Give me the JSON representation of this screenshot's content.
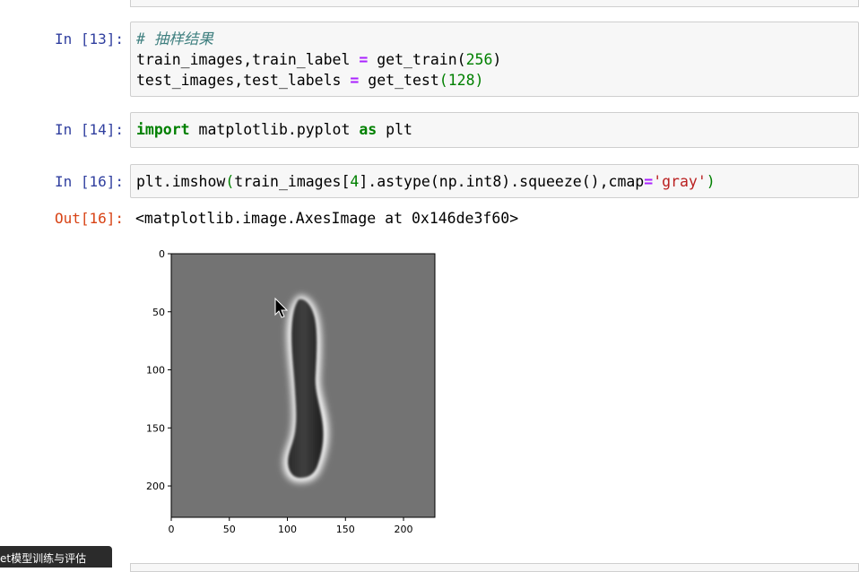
{
  "cells": [
    {
      "prompt": "In [13]:",
      "lines": [
        [
          {
            "t": "# 抽样结果",
            "c": "cmt"
          }
        ],
        [
          {
            "t": "train_images,train_label ",
            "c": ""
          },
          {
            "t": "=",
            "c": "op"
          },
          {
            "t": " get_train(",
            "c": ""
          },
          {
            "t": "256",
            "c": "num"
          },
          {
            "t": ")",
            "c": ""
          }
        ],
        [
          {
            "t": "test_images,test_labels ",
            "c": ""
          },
          {
            "t": "=",
            "c": "op"
          },
          {
            "t": " get_test",
            "c": ""
          },
          {
            "t": "(",
            "c": "paren-g"
          },
          {
            "t": "128",
            "c": "num"
          },
          {
            "t": ")",
            "c": "paren-g"
          }
        ]
      ]
    },
    {
      "prompt": "In [14]:",
      "lines": [
        [
          {
            "t": "import",
            "c": "kw"
          },
          {
            "t": " matplotlib.pyplot ",
            "c": ""
          },
          {
            "t": "as",
            "c": "kw"
          },
          {
            "t": " plt",
            "c": ""
          }
        ]
      ]
    },
    {
      "prompt": "In [16]:",
      "lines": [
        [
          {
            "t": "plt.imshow",
            "c": ""
          },
          {
            "t": "(",
            "c": "paren-g"
          },
          {
            "t": "train_images[",
            "c": ""
          },
          {
            "t": "4",
            "c": "num"
          },
          {
            "t": "].astype(np.int8).squeeze(),cmap",
            "c": ""
          },
          {
            "t": "=",
            "c": "op"
          },
          {
            "t": "'gray'",
            "c": "str"
          },
          {
            "t": ")",
            "c": "paren-g"
          }
        ]
      ]
    }
  ],
  "output": {
    "prompt": "Out[16]:",
    "text": "<matplotlib.image.AxesImage at 0x146de3f60>"
  },
  "plot": {
    "cmap": "gray",
    "xlim": [
      0,
      227
    ],
    "ylim": [
      227,
      0
    ],
    "xticks": [
      "0",
      "50",
      "100",
      "150",
      "200"
    ],
    "yticks": [
      "0",
      "50",
      "100",
      "150",
      "200"
    ],
    "background_color": "#737373"
  },
  "toast": {
    "text": "et模型训练与评估"
  }
}
